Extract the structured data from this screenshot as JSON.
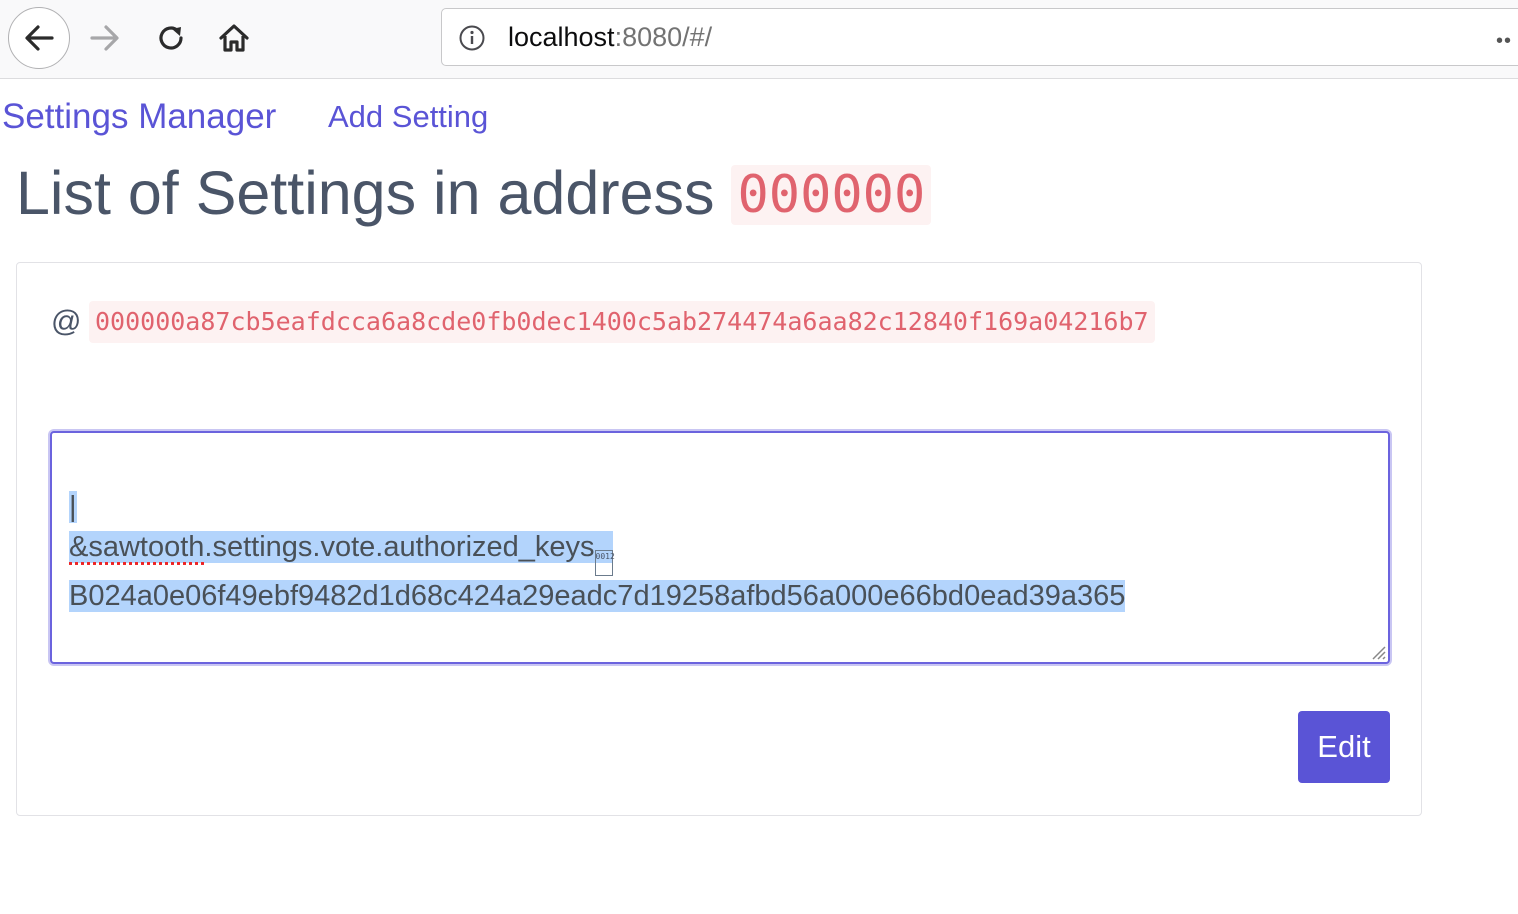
{
  "browser": {
    "url_host": "localhost",
    "url_rest": ":8080/#/",
    "icons": [
      "back-arrow-icon",
      "forward-arrow-icon",
      "reload-icon",
      "home-icon",
      "info-icon",
      "overflow-icon"
    ]
  },
  "nav": {
    "brand": "Settings Manager",
    "add_setting": "Add Setting"
  },
  "page": {
    "title": "List of Settings in address",
    "address_prefix": "000000"
  },
  "card": {
    "at_symbol": "@",
    "address": "000000a87cb5eafdcca6a8cde0fb0dec1400c5ab274474a6aa82c12840f169a04216b7",
    "setting_lines": [
      "|",
      "&sawtooth",
      ".settings.vote.authorized_keys",
      "B024a0e06f49ebf9482d1d68c424a29eadc7d19258afbd56a000e66bd0ead39a365"
    ],
    "ctrl_char_code": "0012",
    "edit_label": "Edit"
  },
  "colors": {
    "accent": "#5a54d6",
    "code_text": "#e0636e",
    "code_bg": "#fdf2f2",
    "selection": "#b3d4fc"
  }
}
